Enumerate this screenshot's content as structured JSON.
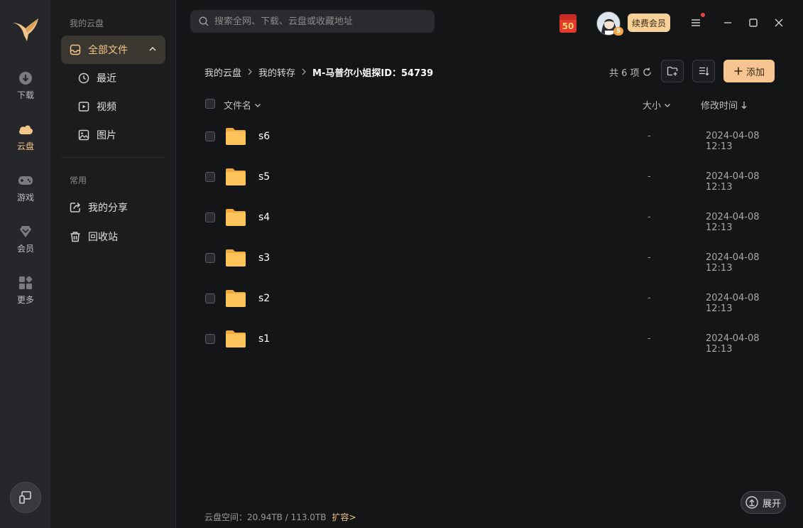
{
  "rail": {
    "items": [
      {
        "label": "下载",
        "icon": "download-icon"
      },
      {
        "label": "云盘",
        "icon": "cloud-icon"
      },
      {
        "label": "游戏",
        "icon": "gamepad-icon"
      },
      {
        "label": "会员",
        "icon": "diamond-icon"
      },
      {
        "label": "更多",
        "icon": "apps-grid-icon"
      }
    ]
  },
  "sidebar": {
    "section_cloud": "我的云盘",
    "all_files": "全部文件",
    "recent": "最近",
    "video": "视频",
    "image": "图片",
    "section_common": "常用",
    "my_share": "我的分享",
    "recycle": "回收站"
  },
  "search": {
    "placeholder": "搜索全网、下载、云盘或收藏地址"
  },
  "header": {
    "redpack_value": "50",
    "vip_level": "5",
    "renew_label": "续费会员"
  },
  "breadcrumb": {
    "root": "我的云盘",
    "level1": "我的转存",
    "current": "M-马普尔小姐探ID：54739"
  },
  "toolbar": {
    "count_text": "共 6 项",
    "add_label": "添加"
  },
  "table": {
    "col_name": "文件名",
    "col_size": "大小",
    "col_modified": "修改时间",
    "rows": [
      {
        "name": "s6",
        "size": "-",
        "date": "2024-04-08 12:13"
      },
      {
        "name": "s5",
        "size": "-",
        "date": "2024-04-08 12:13"
      },
      {
        "name": "s4",
        "size": "-",
        "date": "2024-04-08 12:13"
      },
      {
        "name": "s3",
        "size": "-",
        "date": "2024-04-08 12:13"
      },
      {
        "name": "s2",
        "size": "-",
        "date": "2024-04-08 12:13"
      },
      {
        "name": "s1",
        "size": "-",
        "date": "2024-04-08 12:13"
      }
    ]
  },
  "footer": {
    "storage_text": "云盘空间：20.94TB / 113.0TB",
    "expand_link": "扩容>",
    "expand_button": "展开"
  },
  "colors": {
    "accent": "#f6c588",
    "folder": "#fcc35a",
    "background": "#141517"
  }
}
